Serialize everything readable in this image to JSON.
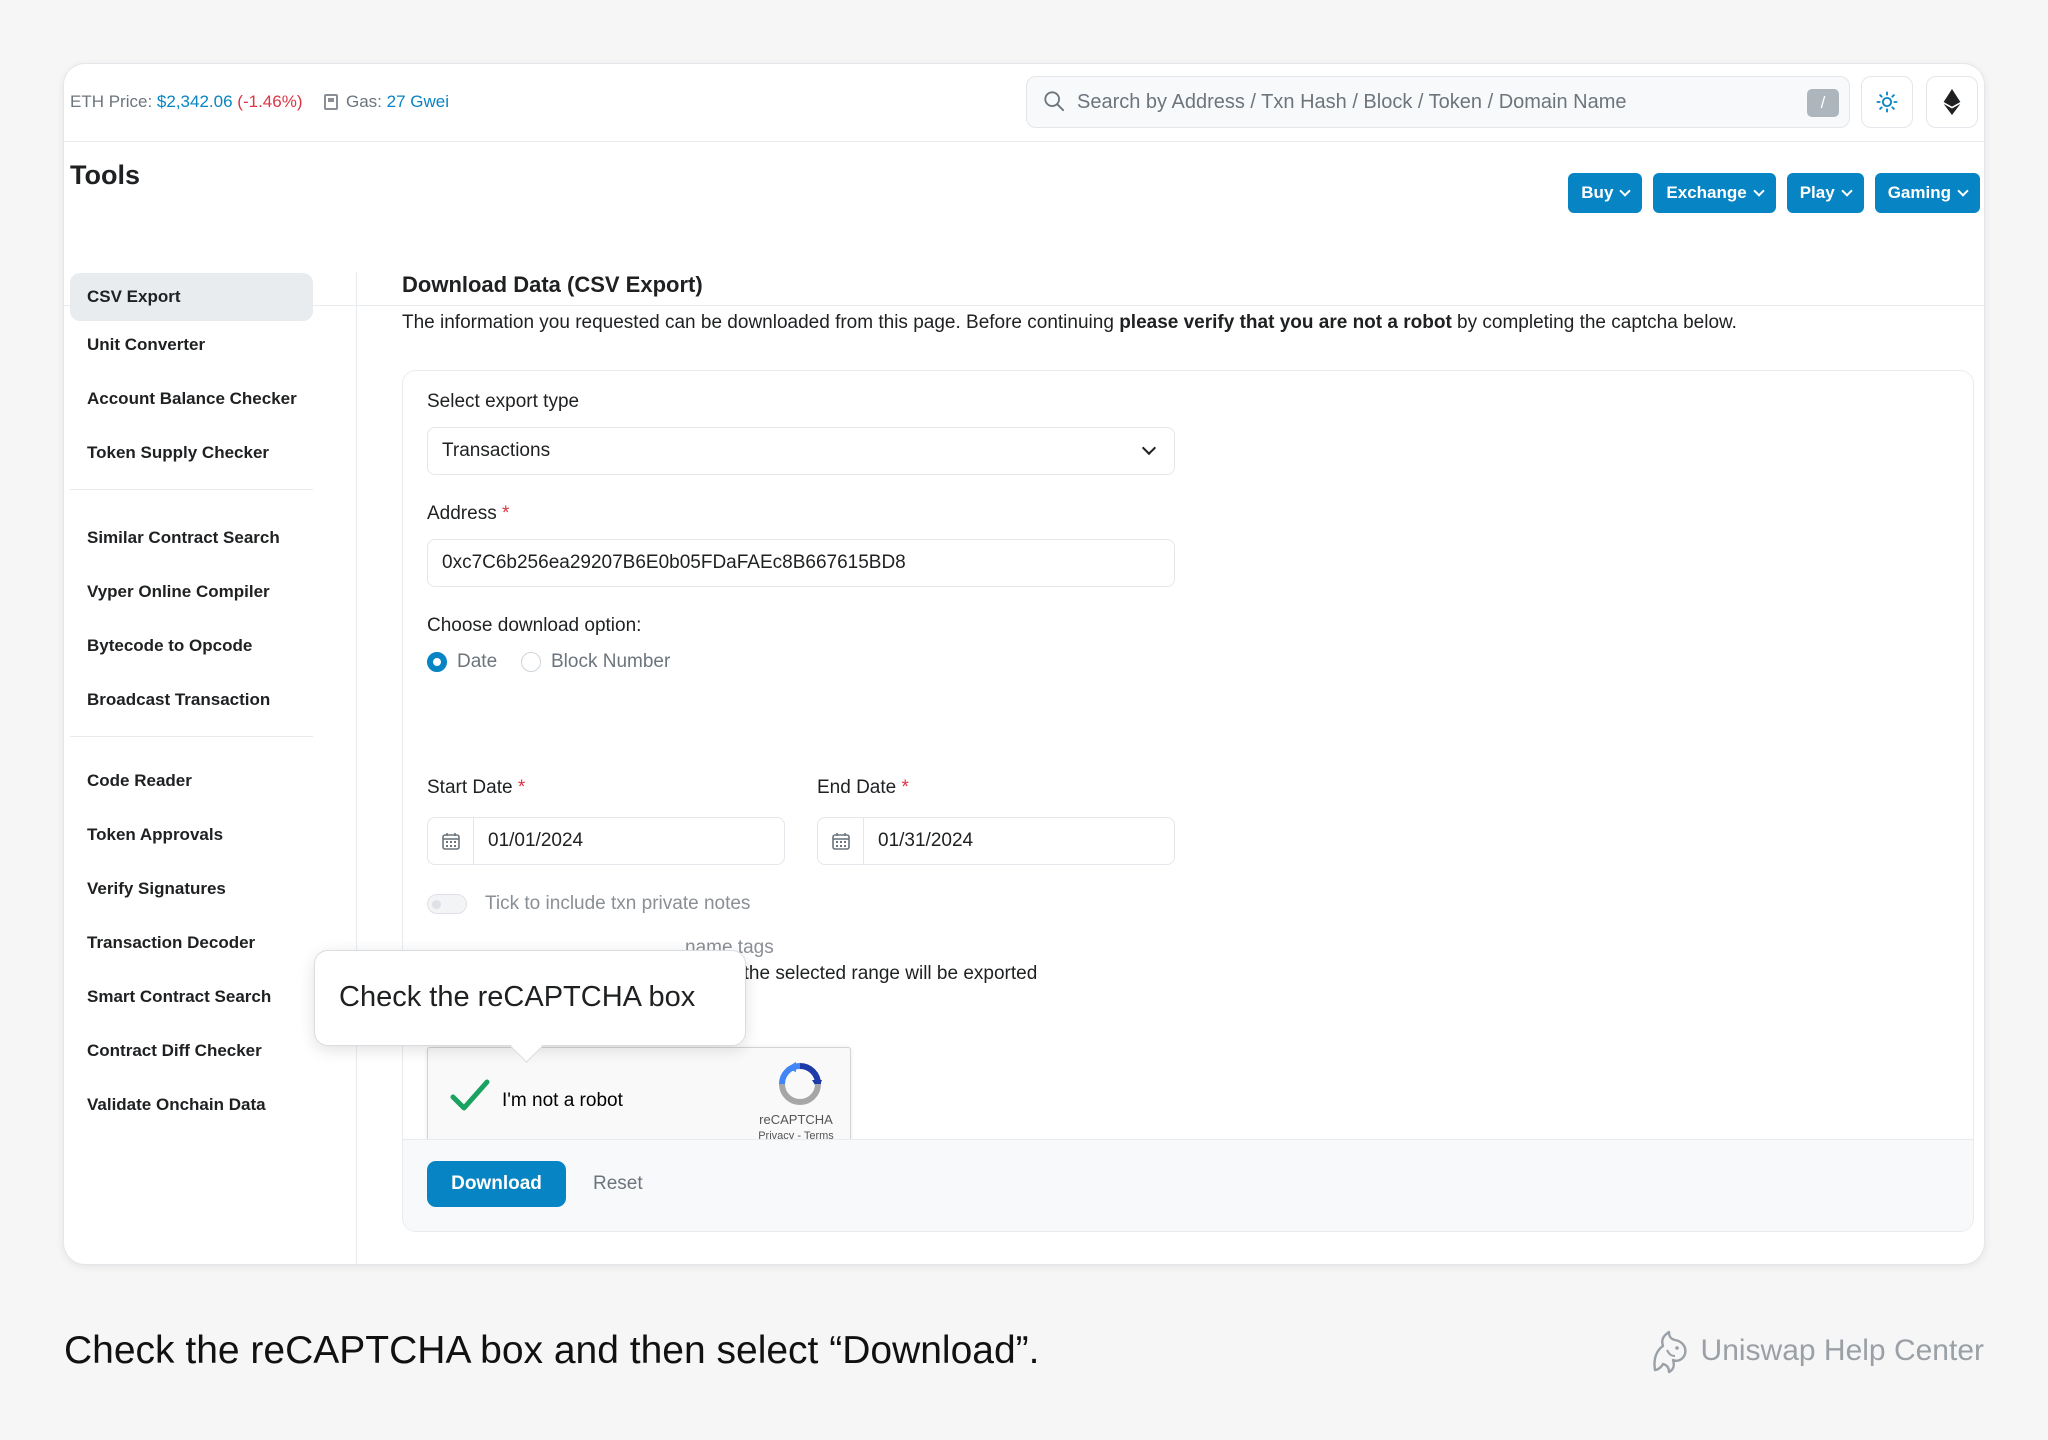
{
  "topbar": {
    "eth_price_label": "ETH Price:",
    "eth_price_value": "$2,342.06",
    "eth_price_change": "(-1.46%)",
    "gas_label": "Gas:",
    "gas_value": "27 Gwei",
    "search_placeholder": "Search by Address / Txn Hash / Block / Token / Domain Name",
    "search_shortcut": "/"
  },
  "header": {
    "title": "Tools",
    "buttons": [
      "Buy",
      "Exchange",
      "Play",
      "Gaming"
    ]
  },
  "sidebar": {
    "groups": [
      [
        "CSV Export",
        "Unit Converter",
        "Account Balance Checker",
        "Token Supply Checker"
      ],
      [
        "Similar Contract Search",
        "Vyper Online Compiler",
        "Bytecode to Opcode",
        "Broadcast Transaction"
      ],
      [
        "Code Reader",
        "Token Approvals",
        "Verify Signatures",
        "Transaction Decoder",
        "Smart Contract Search",
        "Contract Diff Checker",
        "Validate Onchain Data"
      ]
    ],
    "active": "CSV Export"
  },
  "main": {
    "title": "Download Data (CSV Export)",
    "desc_before": "The information you requested can be downloaded from this page. Before continuing ",
    "desc_bold": "please verify that you are not a robot",
    "desc_after": " by completing the captcha below."
  },
  "form": {
    "export_type_label": "Select export type",
    "export_type_value": "Transactions",
    "address_label": "Address",
    "address_value": "0xc7C6b256ea29207B6E0b05FDaFAEc8B667615BD8",
    "download_option_label": "Choose download option:",
    "option_date": "Date",
    "option_block": "Block Number",
    "start_date_label": "Start Date",
    "start_date_value": "01/01/2024",
    "end_date_label": "End Date",
    "end_date_value": "01/31/2024",
    "toggle_notes": "Tick to include txn private notes",
    "toggle_tags_visible": "name tags",
    "export_note_visible": "s within the selected range will be exported",
    "required_mark": "*",
    "download_label": "Download",
    "reset_label": "Reset"
  },
  "recaptcha": {
    "label": "I'm not a robot",
    "brand": "reCAPTCHA",
    "links": "Privacy - Terms",
    "checked": true
  },
  "tooltip": {
    "text": "Check the reCAPTCHA box"
  },
  "caption": {
    "text": "Check the reCAPTCHA box and then select “Download”.",
    "brand": "Uniswap Help Center"
  },
  "colors": {
    "accent": "#0784c3",
    "negative": "#dc3545"
  }
}
